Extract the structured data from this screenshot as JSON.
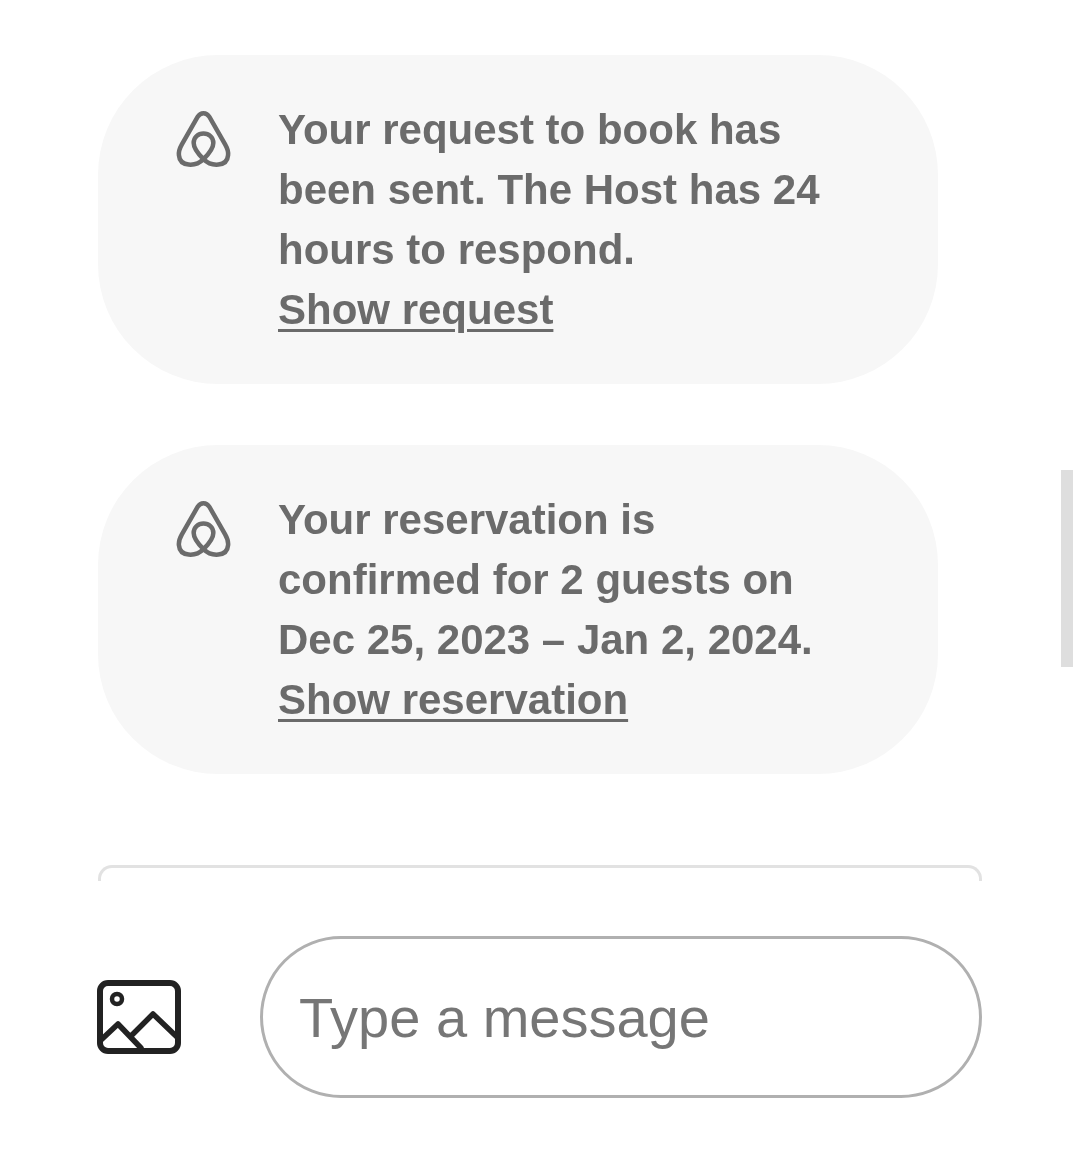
{
  "messages": [
    {
      "text": "Your request to book has been sent. The Host has 24 hours to respond.",
      "link": "Show request"
    },
    {
      "text": "Your reservation is confirmed for 2 guests on Dec 25, 2023 – Jan 2, 2024.",
      "link": "Show reservation"
    }
  ],
  "composer": {
    "placeholder": "Type a message"
  }
}
